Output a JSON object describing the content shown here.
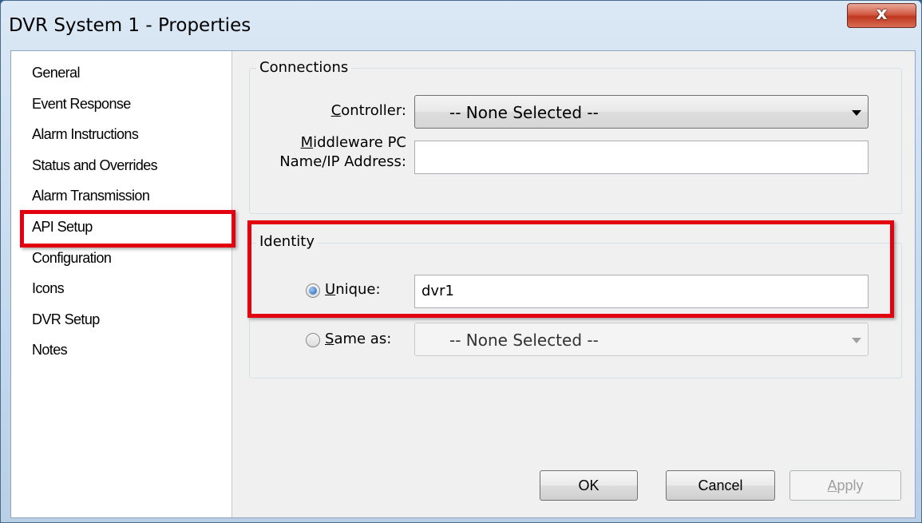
{
  "window": {
    "title": "DVR System 1 - Properties",
    "close_icon": "close-icon"
  },
  "nav": {
    "items": [
      {
        "label": "General"
      },
      {
        "label": "Event Response"
      },
      {
        "label": "Alarm Instructions"
      },
      {
        "label": "Status and Overrides"
      },
      {
        "label": "Alarm Transmission"
      },
      {
        "label": "API Setup"
      },
      {
        "label": "Configuration"
      },
      {
        "label": "Icons"
      },
      {
        "label": "DVR Setup"
      },
      {
        "label": "Notes"
      }
    ],
    "selected": "API Setup"
  },
  "connections": {
    "title": "Connections",
    "controller_label_underlined": "C",
    "controller_label_rest": "ontroller:",
    "controller_value": "-- None Selected --",
    "middleware_label_underlined": "M",
    "middleware_label_rest": "iddleware PC",
    "middleware_label_line2": "Name/IP Address:",
    "middleware_value": ""
  },
  "identity": {
    "title": "Identity",
    "unique_label_underlined": "U",
    "unique_label_rest": "nique:",
    "unique_value": "dvr1",
    "unique_checked": true,
    "same_as_label_underlined": "S",
    "same_as_label_rest": "ame as:",
    "same_as_value": "-- None Selected --",
    "same_as_checked": false
  },
  "buttons": {
    "ok": "OK",
    "cancel": "Cancel",
    "apply_underlined": "A",
    "apply_rest": "pply"
  },
  "colors": {
    "highlight": "#e3000f"
  }
}
